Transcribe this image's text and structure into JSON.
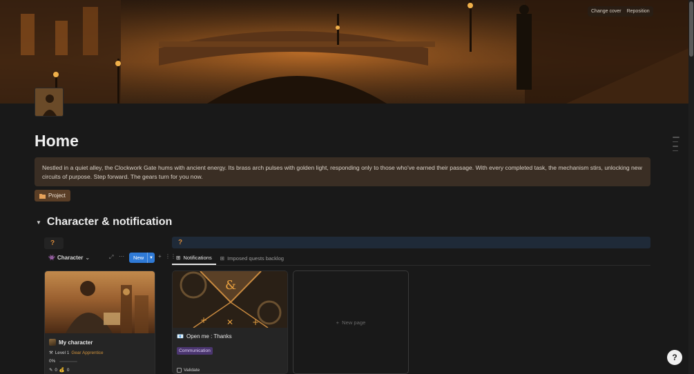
{
  "cover": {
    "change_label": "Change cover",
    "reposition_label": "Reposition"
  },
  "page": {
    "title": "Home",
    "callout": "Nestled in a quiet alley, the Clockwork Gate hums with ancient energy. Its brass arch pulses with golden light, responding only to those who've earned their passage. With every completed task, the mechanism stirs, unlocking new circuits of purpose. Step forward. The gears turn for you now.",
    "project_button": "Project"
  },
  "section": {
    "title": "Character & notification"
  },
  "left_placeholder": "?",
  "right_placeholder": "?",
  "character_db": {
    "label": "Character",
    "new_label": "New",
    "card": {
      "title": "My character",
      "level": "Level 1",
      "rank": "Gear Apprentice",
      "progress": "0%",
      "stat_a": "0",
      "stat_b": "0"
    }
  },
  "notifications_db": {
    "tabs": [
      "Notifications",
      "Imposed quests backlog"
    ],
    "card": {
      "title": "Open me : Thanks",
      "tag": "Communication",
      "checkbox_label": "Validate"
    },
    "new_page_label": "New page"
  },
  "help": {
    "label": "?"
  },
  "colors": {
    "accent": "#2f7ad6",
    "gold": "#d2933c",
    "tag_purple": "#4b3670",
    "callout_bg": "#3a2e24"
  }
}
